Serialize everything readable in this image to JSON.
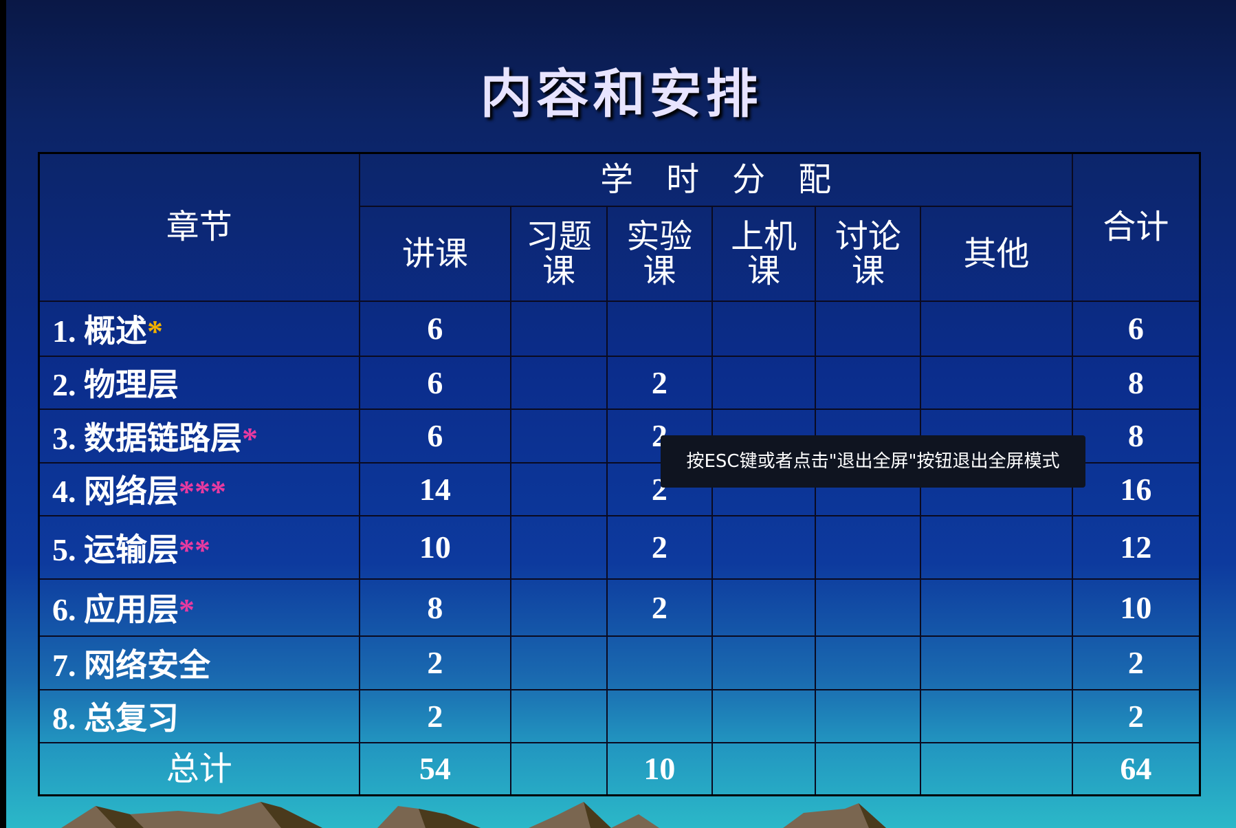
{
  "title": "内容和安排",
  "header": {
    "chapter": "章节",
    "allocation": "学　时　分　配",
    "total": "合计",
    "cols": [
      "讲课",
      "习题\n课",
      "实验\n课",
      "上机\n课",
      "讨论\n课",
      "其他"
    ]
  },
  "rows": [
    {
      "chapter": "1. 概述",
      "stars": "*",
      "star_color": "#f0b000",
      "cells": [
        "6",
        "",
        "",
        "",
        "",
        ""
      ],
      "total": "6"
    },
    {
      "chapter": "2. 物理层",
      "stars": "",
      "cells": [
        "6",
        "",
        "2",
        "",
        "",
        ""
      ],
      "total": "8"
    },
    {
      "chapter": "3. 数据链路层",
      "stars": "*",
      "star_color": "#e83aa0",
      "cells": [
        "6",
        "",
        "2",
        "",
        "",
        ""
      ],
      "total": "8"
    },
    {
      "chapter": "4. 网络层",
      "stars": "***",
      "star_color": "#e83aa0",
      "cells": [
        "14",
        "",
        "2",
        "",
        "",
        ""
      ],
      "total": "16"
    },
    {
      "chapter": "5. 运输层",
      "stars": "**",
      "star_color": "#e83aa0",
      "cells": [
        "10",
        "",
        "2",
        "",
        "",
        ""
      ],
      "total": "12"
    },
    {
      "chapter": "6. 应用层",
      "stars": "*",
      "star_color": "#e83aa0",
      "cells": [
        "8",
        "",
        "2",
        "",
        "",
        ""
      ],
      "total": "10"
    },
    {
      "chapter": "7. 网络安全",
      "stars": "",
      "cells": [
        "2",
        "",
        "",
        "",
        "",
        ""
      ],
      "total": "2"
    },
    {
      "chapter": "8. 总复习",
      "stars": "",
      "cells": [
        "2",
        "",
        "",
        "",
        "",
        ""
      ],
      "total": "2"
    }
  ],
  "footer": {
    "label": "总计",
    "cells": [
      "54",
      "",
      "10",
      "",
      "",
      ""
    ],
    "total": "64"
  },
  "tooltip": "按ESC键或者点击\"退出全屏\"按钮退出全屏模式"
}
